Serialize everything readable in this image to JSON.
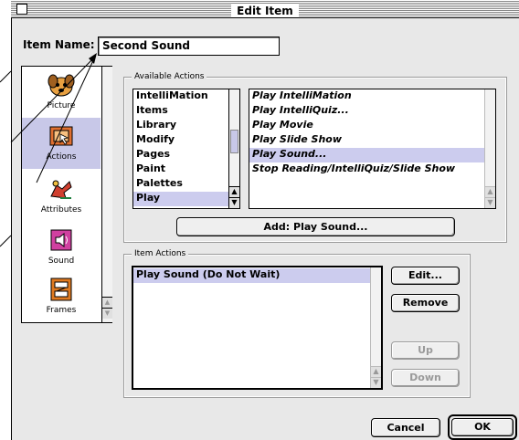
{
  "window": {
    "title": "Edit Item"
  },
  "item_name": {
    "label": "Item Name:",
    "value": "Second Sound"
  },
  "categories": [
    {
      "label": "Picture",
      "icon": "picture-dog-icon",
      "selected": false
    },
    {
      "label": "Actions",
      "icon": "actions-pointer-icon",
      "selected": true
    },
    {
      "label": "Attributes",
      "icon": "attributes-bird-icon",
      "selected": false
    },
    {
      "label": "Sound",
      "icon": "speaker-icon",
      "selected": false
    },
    {
      "label": "Frames",
      "icon": "film-frames-icon",
      "selected": false
    }
  ],
  "available_actions": {
    "group_label": "Available Actions",
    "categories": [
      "IntelliMation",
      "Items",
      "Library",
      "Modify",
      "Pages",
      "Paint",
      "Palettes",
      "Play"
    ],
    "selected_category": "Play",
    "actions": [
      "Play IntelliMation",
      "Play IntelliQuiz...",
      "Play Movie",
      "Play Slide Show",
      "Play Sound...",
      "Stop Reading/IntelliQuiz/Slide Show"
    ],
    "selected_action": "Play Sound...",
    "add_button": "Add:  Play Sound..."
  },
  "item_actions": {
    "group_label": "Item Actions",
    "items": [
      "Play Sound (Do Not Wait)"
    ],
    "buttons": {
      "edit": "Edit...",
      "remove": "Remove",
      "up": "Up",
      "down": "Down"
    }
  },
  "footer": {
    "cancel": "Cancel",
    "ok": "OK"
  },
  "colors": {
    "selection": "#ccccee",
    "dialog_bg": "#e8e8e8"
  }
}
